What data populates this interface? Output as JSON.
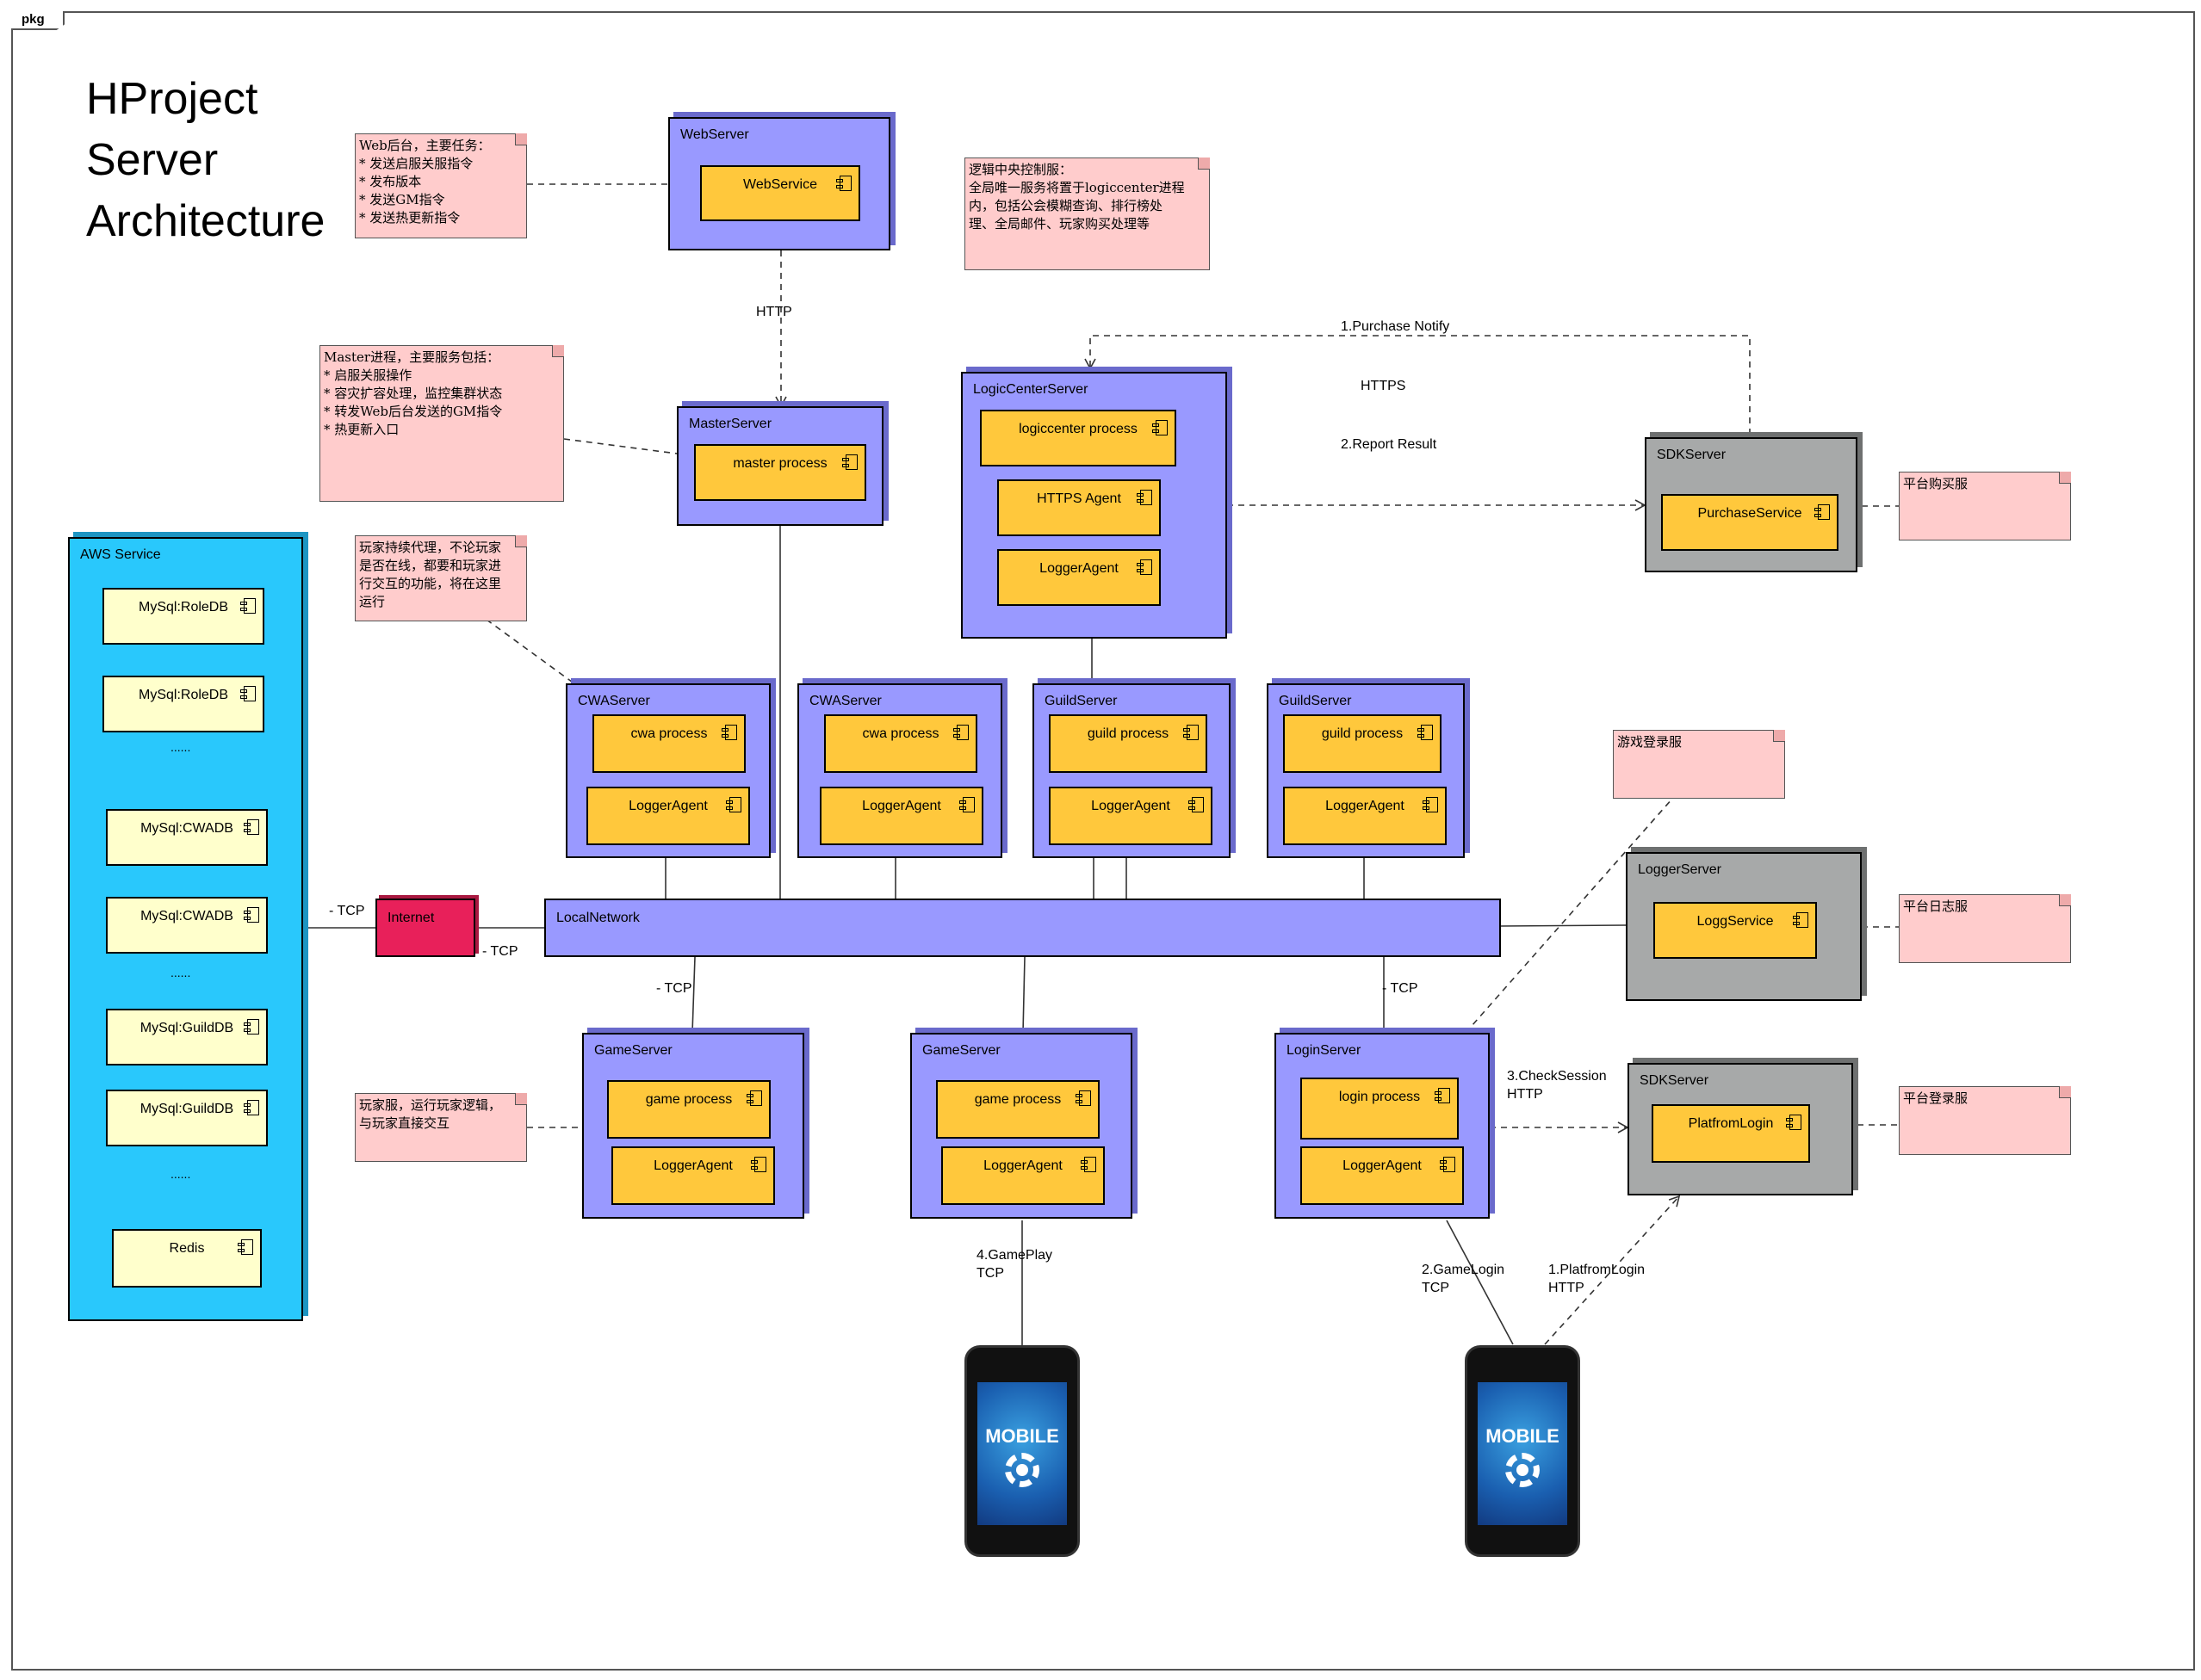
{
  "frame": {
    "tab": "pkg"
  },
  "title": "HProject\nServer\nArchitecture",
  "nodes": {
    "aws": "AWS Service",
    "webserver": "WebServer",
    "masterserver": "MasterServer",
    "logiccenter": "LogicCenterServer",
    "sdk_purchase": "SDKServer",
    "cwa1": "CWAServer",
    "cwa2": "CWAServer",
    "guild1": "GuildServer",
    "guild2": "GuildServer",
    "loggerserver": "LoggerServer",
    "internet": "Internet",
    "localnetwork": "LocalNetwork",
    "game1": "GameServer",
    "game2": "GameServer",
    "login": "LoginServer",
    "sdk_login": "SDKServer"
  },
  "components": {
    "webservice": "WebService",
    "master_process": "master process",
    "logiccenter_process": "logiccenter process",
    "https_agent": "HTTPS Agent",
    "lc_logger": "LoggerAgent",
    "purchase_service": "PurchaseService",
    "cwa1_process": "cwa process",
    "cwa1_logger": "LoggerAgent",
    "cwa2_process": "cwa process",
    "cwa2_logger": "LoggerAgent",
    "guild1_process": "guild process",
    "guild1_logger": "LoggerAgent",
    "guild2_process": "guild process",
    "guild2_logger": "LoggerAgent",
    "logg_service": "LoggService",
    "game1_process": "game process",
    "game1_logger": "LoggerAgent",
    "game2_process": "game process",
    "game2_logger": "LoggerAgent",
    "login_process": "login process",
    "login_logger": "LoggerAgent",
    "platform_login": "PlatfromLogin"
  },
  "databases": [
    "MySql:RoleDB",
    "MySql:RoleDB",
    "MySql:CWADB",
    "MySql:CWADB",
    "MySql:GuildDB",
    "MySql:GuildDB",
    "Redis"
  ],
  "ellipsis": "......",
  "notes": {
    "web": "Web后台，主要任务：\n* 发送启服关服指令\n* 发布版本\n* 发送GM指令\n* 发送热更新指令",
    "logic": "逻辑中央控制服：\n全局唯一服务将置于logiccenter进程\n内，包括公会模糊查询、排行榜处\n理、全局邮件、玩家购买处理等",
    "master": "Master进程，主要服务包括：\n* 启服关服操作\n* 容灾扩容处理，监控集群状态\n* 转发Web后台发送的GM指令\n* 热更新入口",
    "cwa": "玩家持续代理，不论玩家\n是否在线，都要和玩家进\n行交互的功能，将在这里\n运行",
    "game": "玩家服，运行玩家逻辑，\n与玩家直接交互",
    "login_game": "游戏登录服",
    "purchase": "平台购买服",
    "logger": "平台日志服",
    "login_platform": "平台登录服"
  },
  "labels": {
    "http": "HTTP",
    "purchase_notify": "1.Purchase Notify",
    "https": "HTTPS",
    "report_result": "2.Report Result",
    "tcp_aws": "- TCP",
    "tcp_internet": "- TCP",
    "tcp_game": "- TCP",
    "tcp_login": "- TCP",
    "check_session": "3.CheckSession\nHTTP",
    "gameplay": "4.GamePlay\nTCP",
    "gamelogin": "2.GameLogin\nTCP",
    "platformlogin": "1.PlatfromLogin\nHTTP",
    "mobile": "MOBILE"
  },
  "colors": {
    "node": "#9999ff",
    "component": "#ffc83c",
    "database": "#ffffcc",
    "aws": "#29c8fc",
    "sdk": "#a7a9a9",
    "internet": "#e8205a",
    "note": "#ffcccc"
  }
}
